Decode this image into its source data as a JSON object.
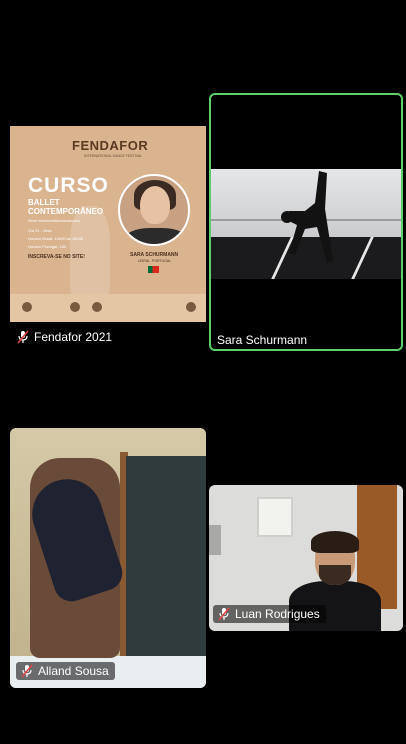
{
  "participants": [
    {
      "name": "Fendafor 2021",
      "muted": true,
      "poster": {
        "brand": "FENDAFOR",
        "brand_sub": "INTERNATIONAL DANCE FESTIVAL",
        "title": "CURSO",
        "course_line1": "BALLET",
        "course_line2": "CONTEMPORÂNEO",
        "level": "Nível intermediário/avançado",
        "dates": "Dia 01 - Maio",
        "time_brazil": "Horário Brasil: 14h00 às 15h00",
        "time_portugal": "Horário Portugal: 18h",
        "signup": "INSCREVA-SE NO SITE!",
        "teacher": "SARA SCHURMANN",
        "place": "LEIRIA - PORTUGAL"
      }
    },
    {
      "name": "Sara Schurmann",
      "muted": false,
      "active_speaker": true
    },
    {
      "name": "Alland Sousa",
      "muted": true
    },
    {
      "name": "Luan Rodrigues",
      "muted": true
    }
  ],
  "colors": {
    "active_border": "#5fcf6e",
    "background": "#000000",
    "poster_bg": "#d9b48f"
  },
  "icons": {
    "muted": "mic-off-icon"
  }
}
